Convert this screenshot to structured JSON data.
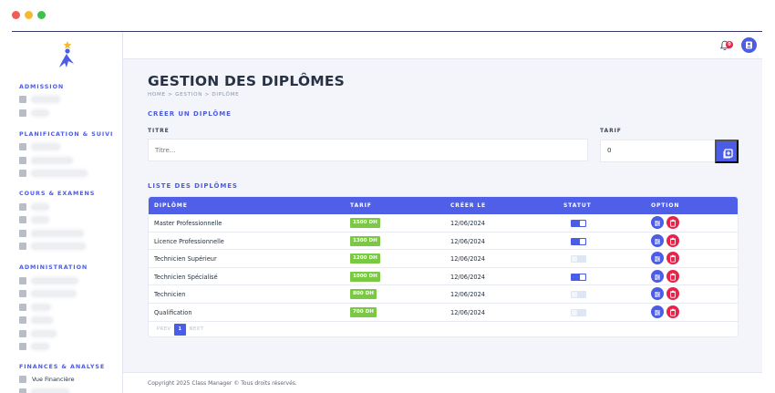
{
  "sidebar": {
    "sections": {
      "admission": "ADMISSION",
      "planification": "PLANIFICATION & SUIVI",
      "cours": "COURS & EXAMENS",
      "administration": "ADMINISTRATION",
      "finances": "FINANCES & ANALYSE"
    },
    "finance_item": "Vue Financière"
  },
  "topbar": {
    "notification_count": "0"
  },
  "page": {
    "title": "GESTION DES DIPLÔMES",
    "breadcrumb": "HOME > GESTION > DIPLÔME"
  },
  "create_form": {
    "heading": "CRÉER UN DIPLÔME",
    "titre_label": "TITRE",
    "titre_placeholder": "Titre...",
    "tarif_label": "TARIF",
    "tarif_value": "0"
  },
  "list": {
    "heading": "LISTE DES DIPLÔMES",
    "columns": [
      "DIPLÔME",
      "TARIF",
      "CRÉER LE",
      "STATUT",
      "OPTION"
    ],
    "rows": [
      {
        "name": "Master Professionnelle",
        "tarif": "1500 DH",
        "date": "12/06/2024",
        "active": true
      },
      {
        "name": "Licence Professionnelle",
        "tarif": "1300 DH",
        "date": "12/06/2024",
        "active": true
      },
      {
        "name": "Technicien Supérieur",
        "tarif": "1200 DH",
        "date": "12/06/2024",
        "active": false
      },
      {
        "name": "Technicien Spécialisé",
        "tarif": "1000 DH",
        "date": "12/06/2024",
        "active": true
      },
      {
        "name": "Technicien",
        "tarif": "800 DH",
        "date": "12/06/2024",
        "active": false
      },
      {
        "name": "Qualification",
        "tarif": "700 DH",
        "date": "12/06/2024",
        "active": false
      }
    ],
    "pagination": {
      "prev": "PREV",
      "current": "1",
      "next": "NEXT"
    }
  },
  "footer": {
    "text": "Copyright 2025 Class Manager © Tous droits réservés."
  },
  "colors": {
    "accent": "#4b5ce6",
    "danger": "#e8234a",
    "success": "#7ac943"
  },
  "icons": [
    "bell-icon",
    "user-icon",
    "add-icon",
    "edit-icon",
    "delete-icon",
    "logo-icon"
  ]
}
